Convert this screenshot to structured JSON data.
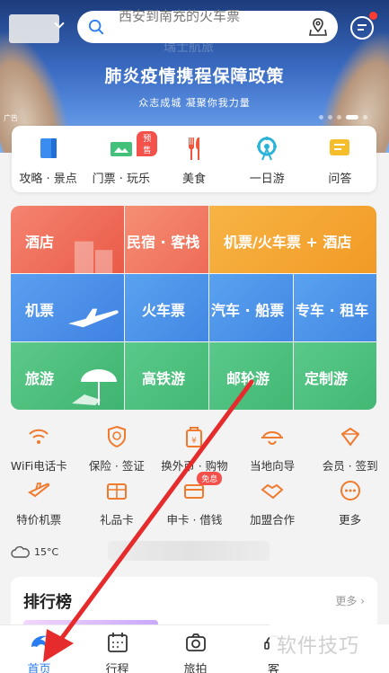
{
  "header": {
    "search_text": "西安到南充的火车票"
  },
  "banner": {
    "faint_text": "瑞士航旅",
    "title": "肺炎疫情携程保障政策",
    "subtitle": "众志成城 凝聚你我力量",
    "ad_label": "广告"
  },
  "quick_nav": [
    {
      "label": "攻略 · 景点",
      "icon": "guide-icon"
    },
    {
      "label": "门票 · 玩乐",
      "icon": "ticket-icon",
      "badge": "预售"
    },
    {
      "label": "美食",
      "icon": "food-icon"
    },
    {
      "label": "一日游",
      "icon": "ferris-wheel-icon"
    },
    {
      "label": "问答",
      "icon": "qa-icon"
    }
  ],
  "main_grid": {
    "hotel": "酒店",
    "homestay": "民宿 · 客栈",
    "flight_train_hotel": "机票/火车票 + 酒店",
    "flight": "机票",
    "train": "火车票",
    "bus_ship": "汽车 · 船票",
    "car_rental": "专车 · 租车",
    "tour": "旅游",
    "high_speed_tour": "高铁游",
    "cruise": "邮轮游",
    "custom": "定制游"
  },
  "services_row1": [
    {
      "label": "WiFi电话卡",
      "icon": "wifi-icon"
    },
    {
      "label": "保险 · 签证",
      "icon": "insurance-icon"
    },
    {
      "label": "换外币 · 购物",
      "icon": "currency-icon"
    },
    {
      "label": "当地向导",
      "icon": "guide-hat-icon"
    },
    {
      "label": "会员 · 签到",
      "icon": "member-icon"
    }
  ],
  "services_row2": [
    {
      "label": "特价机票",
      "icon": "plane-icon"
    },
    {
      "label": "礼品卡",
      "icon": "gift-card-icon"
    },
    {
      "label": "申卡 · 借钱",
      "icon": "card-icon",
      "badge": "免息"
    },
    {
      "label": "加盟合作",
      "icon": "handshake-icon"
    },
    {
      "label": "更多",
      "icon": "more-icon"
    }
  ],
  "weather": {
    "temp": "15°C"
  },
  "ranking": {
    "title": "排行榜",
    "more": "更多 ›"
  },
  "tabbar": [
    {
      "label": "首页",
      "icon": "home-dolphin-icon",
      "active": true
    },
    {
      "label": "行程",
      "icon": "calendar-icon"
    },
    {
      "label": "旅拍",
      "icon": "camera-icon"
    },
    {
      "label": "客",
      "icon": "service-icon"
    }
  ],
  "watermark": "软件技巧",
  "colors": {
    "accent_blue": "#2a7df0",
    "hotel_red": "#f06a55",
    "transport_blue": "#4f93e8",
    "tour_green": "#4fc07e",
    "combo_orange": "#f5a632",
    "arrow_red": "#e52b2b"
  }
}
